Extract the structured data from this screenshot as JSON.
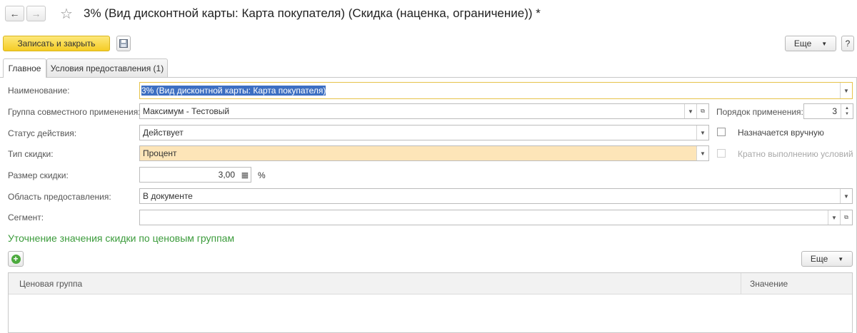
{
  "window": {
    "title": "3% (Вид дисконтной карты: Карта покупателя) (Скидка (наценка, ограничение)) *"
  },
  "toolbar": {
    "save_close_label": "Записать и закрыть",
    "more_label": "Еще",
    "help_label": "?"
  },
  "tabs": [
    {
      "label": "Главное"
    },
    {
      "label": "Условия предоставления (1)"
    }
  ],
  "form": {
    "name_label": "Наименование:",
    "name_value": "3% (Вид дисконтной карты: Карта покупателя)",
    "group_label": "Группа совместного применения:",
    "group_value": "Максимум - Тестовый",
    "order_label": "Порядок применения:",
    "order_value": "3",
    "status_label": "Статус действия:",
    "status_value": "Действует",
    "manual_label": "Назначается вручную",
    "type_label": "Тип скидки:",
    "type_value": "Процент",
    "multiple_label": "Кратно выполнению условий",
    "size_label": "Размер скидки:",
    "size_value": "3,00",
    "size_unit": "%",
    "area_label": "Область предоставления:",
    "area_value": "В документе",
    "segment_label": "Сегмент:",
    "segment_value": ""
  },
  "section": {
    "title": "Уточнение значения скидки по ценовым группам",
    "more_label": "Еще"
  },
  "table": {
    "columns": [
      "Ценовая группа",
      "Значение"
    ],
    "rows": []
  },
  "colors": {
    "accent_green": "#3b9b3b",
    "save_button": "#f5cc25",
    "highlight_field": "#fde5b8"
  }
}
